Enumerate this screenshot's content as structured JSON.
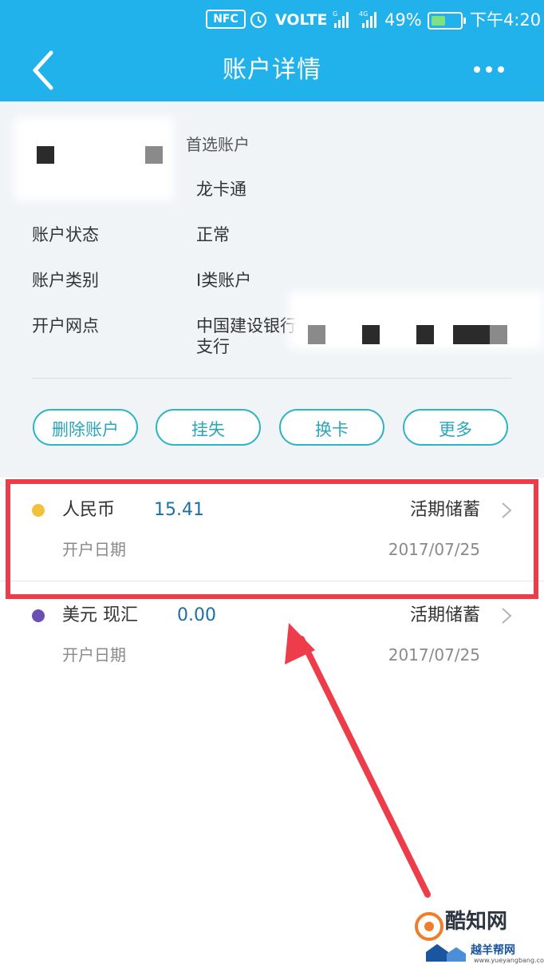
{
  "status_bar": {
    "nfc": "NFC",
    "volte": "VOLTE",
    "signal_1": "G",
    "signal_2": "4G",
    "battery_percent": "49%",
    "time": "下午4:20",
    "battery_level": 0.49
  },
  "header": {
    "title": "账户详情",
    "back_icon": "chevron-left-icon",
    "more_icon": "more-dots-icon",
    "background_color": "#21b2ec"
  },
  "account": {
    "preferred_tag": "首选账户",
    "card_name": "龙卡通",
    "fields": [
      {
        "label": "账户状态",
        "value": "正常"
      },
      {
        "label": "账户类别",
        "value": "I类账户"
      },
      {
        "label": "开户网点",
        "value": "中国建设银行",
        "value_line2": "支行"
      }
    ]
  },
  "actions": [
    {
      "label": "删除账户"
    },
    {
      "label": "挂失"
    },
    {
      "label": "换卡"
    },
    {
      "label": "更多"
    }
  ],
  "sub_accounts": [
    {
      "currency": "人民币",
      "amount": "15.41",
      "type": "活期储蓄",
      "open_label": "开户日期",
      "open_date": "2017/07/25",
      "dot_color": "#f2c13b"
    },
    {
      "currency": "美元 现汇",
      "amount": "0.00",
      "type": "活期储蓄",
      "open_label": "开户日期",
      "open_date": "2017/07/25",
      "dot_color": "#6a4fb5"
    }
  ],
  "annotation_color": "#ee3d4a",
  "watermark": {
    "name": "酷知网",
    "sub": "越羊帮网",
    "url": "www.yueyangbang.com"
  }
}
